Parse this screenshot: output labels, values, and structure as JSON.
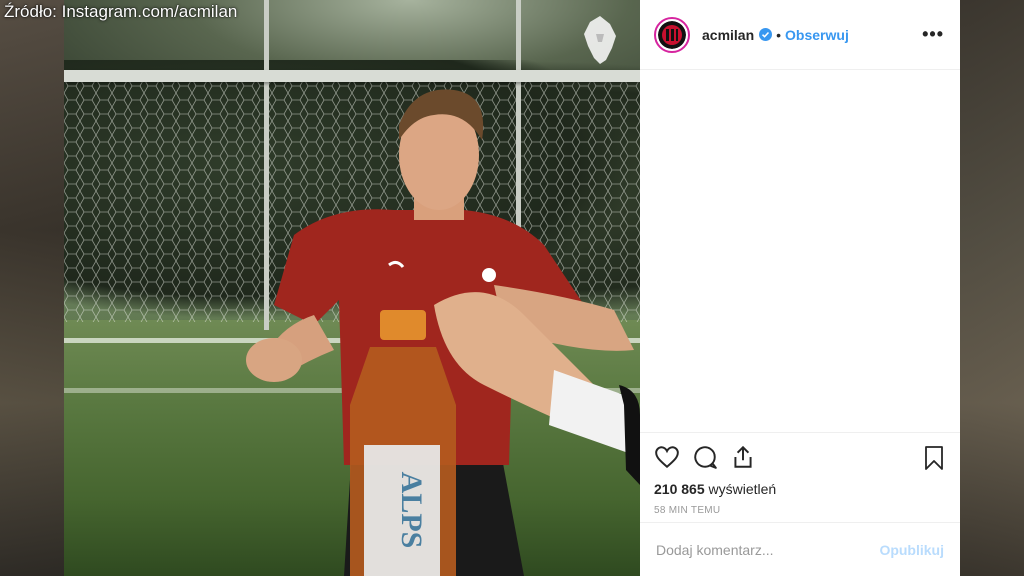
{
  "source_label": "Źródło: Instagram.com/acmilan",
  "post": {
    "username": "acmilan",
    "separator": "•",
    "follow_label": "Obserwuj",
    "more_label": "•••",
    "views_count": "210 865",
    "views_label": "wyświetleń",
    "time_ago": "58 MIN TEMU",
    "comment_placeholder": "Dodaj komentarz...",
    "publish_label": "Opublikuj"
  },
  "video": {
    "bottle_label": "ALPS"
  },
  "colors": {
    "follow": "#3897f0",
    "publish_disabled": "#b9dcfd",
    "verified": "#3897f0",
    "jersey": "#a0261e"
  },
  "icons": [
    "heart-icon",
    "comment-icon",
    "share-icon",
    "bookmark-icon",
    "verified-icon",
    "lion-logo-icon",
    "milan-crest-icon"
  ]
}
